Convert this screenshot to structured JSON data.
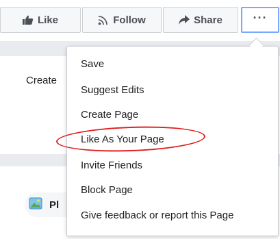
{
  "action_bar": {
    "like_label": "Like",
    "follow_label": "Follow",
    "share_label": "Share",
    "more_label": "···"
  },
  "background": {
    "create_label": "Create",
    "bottom_label": "Pl"
  },
  "menu": {
    "items": [
      {
        "label": "Save"
      },
      {
        "label": "Suggest Edits"
      },
      {
        "label": "Create Page"
      },
      {
        "label": "Like As Your Page"
      },
      {
        "label": "Invite Friends"
      },
      {
        "label": "Block Page"
      },
      {
        "label": "Give feedback or report this Page"
      }
    ],
    "highlighted_item": "Like As Your Page",
    "highlight_color": "#e02020"
  },
  "colors": {
    "accent_border": "#7aa7ff",
    "button_text": "#4b4f56",
    "page_bg": "#e9ebee"
  },
  "icons": {
    "like": "thumbs-up-icon",
    "follow": "rss-icon",
    "share": "share-arrow-icon",
    "photo": "photo-icon"
  }
}
